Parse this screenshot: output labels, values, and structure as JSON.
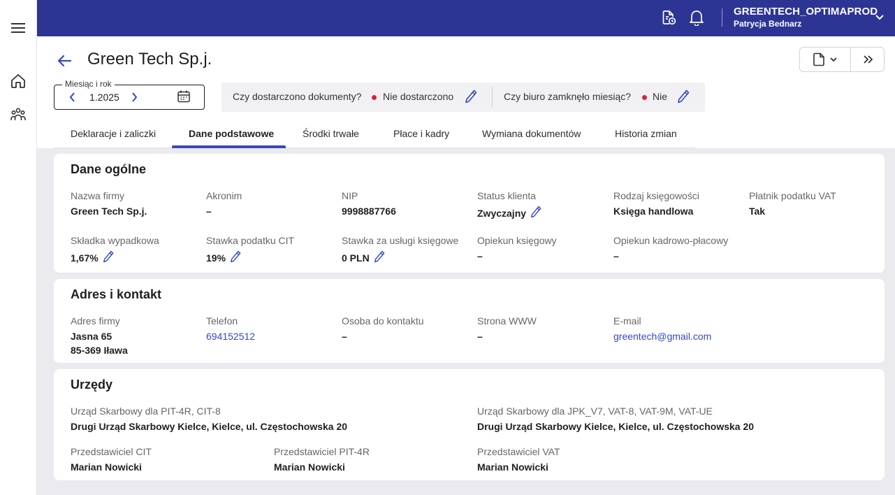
{
  "topbar": {
    "tenant": "GREENTECH_OPTIMAPROD",
    "user": "Patrycja Bednarz",
    "brand_color": "#2d3594"
  },
  "header": {
    "title": "Green Tech Sp.j.",
    "month_label": "Miesiąc i rok",
    "month_value": "1.2025"
  },
  "status": {
    "docs_question": "Czy dostarczono dokumenty?",
    "docs_answer": "Nie dostarczono",
    "close_question": "Czy biuro zamknęło miesiąc?",
    "close_answer": "Nie",
    "dot_color": "#d8213b"
  },
  "tabs": [
    {
      "label": "Deklaracje i zaliczki"
    },
    {
      "label": "Dane podstawowe"
    },
    {
      "label": "Środki trwałe"
    },
    {
      "label": "Płace i kadry"
    },
    {
      "label": "Wymiana dokumentów"
    },
    {
      "label": "Historia zmian"
    }
  ],
  "general": {
    "heading": "Dane ogólne",
    "company_name": {
      "label": "Nazwa firmy",
      "value": "Green Tech Sp.j."
    },
    "acronym": {
      "label": "Akronim",
      "value": "–"
    },
    "nip": {
      "label": "NIP",
      "value": "9998887766"
    },
    "client_status": {
      "label": "Status klienta",
      "value": "Zwyczajny"
    },
    "accounting_type": {
      "label": "Rodzaj księgowości",
      "value": "Księga handlowa"
    },
    "vat_payer": {
      "label": "Płatnik podatku VAT",
      "value": "Tak"
    },
    "accident_rate": {
      "label": "Składka wypadkowa",
      "value": "1,67%"
    },
    "cit_rate": {
      "label": "Stawka podatku CIT",
      "value": "19%"
    },
    "fee": {
      "label": "Stawka za usługi księgowe",
      "value": "0 PLN"
    },
    "accountant": {
      "label": "Opiekun księgowy",
      "value": "–"
    },
    "payroll_keeper": {
      "label": "Opiekun kadrowo-płacowy",
      "value": "–"
    }
  },
  "address": {
    "heading": "Adres i kontakt",
    "company_address": {
      "label": "Adres firmy",
      "line1": "Jasna 65",
      "line2": "85-369 Iława"
    },
    "phone": {
      "label": "Telefon",
      "value": "694152512"
    },
    "contact_person": {
      "label": "Osoba do kontaktu",
      "value": "–"
    },
    "website": {
      "label": "Strona WWW",
      "value": "–"
    },
    "email": {
      "label": "E-mail",
      "value": "greentech@gmail.com"
    }
  },
  "offices": {
    "heading": "Urzędy",
    "pit_office": {
      "label": "Urząd Skarbowy dla PIT-4R, CIT-8",
      "value": "Drugi Urząd Skarbowy Kielce, Kielce, ul. Częstochowska 20"
    },
    "vat_office": {
      "label": "Urząd Skarbowy dla JPK_V7, VAT-8, VAT-9M, VAT-UE",
      "value": "Drugi Urząd Skarbowy Kielce, Kielce, ul. Częstochowska 20"
    },
    "cit_rep": {
      "label": "Przedstawiciel CIT",
      "value": "Marian Nowicki"
    },
    "pit_rep": {
      "label": "Przedstawiciel PIT-4R",
      "value": "Marian Nowicki"
    },
    "vat_rep": {
      "label": "Przedstawiciel VAT",
      "value": "Marian Nowicki"
    }
  }
}
